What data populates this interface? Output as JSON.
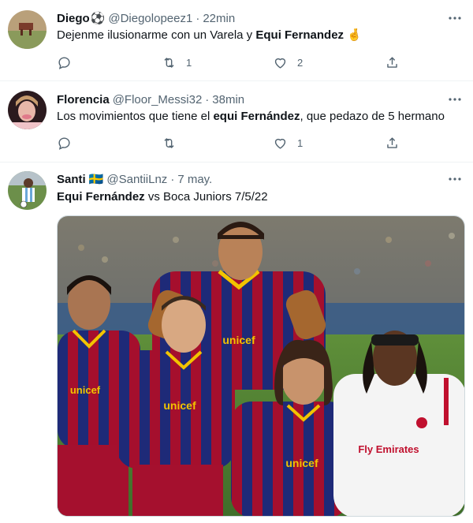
{
  "tweets": [
    {
      "name": "Diego",
      "badge": "⚽",
      "handle": "@Diegolopeez1",
      "time": "22min",
      "text_parts": [
        "Dejenme ilusionarme con un Varela y ",
        "Equi Fernandez",
        " 🤞"
      ],
      "replies": "",
      "retweets": "1",
      "likes": "2"
    },
    {
      "name": "Florencia",
      "handle": "@Floor_Messi32",
      "time": "38min",
      "text_parts": [
        "Los movimientos que tiene el ",
        "equi Fernández",
        ", que pedazo de 5 hermano"
      ],
      "replies": "",
      "retweets": "",
      "likes": "1"
    },
    {
      "name": "Santi",
      "badge": "🇸🇪",
      "handle": "@SantiiLnz",
      "time": "7 may.",
      "text_parts": [
        "Equi Fernández",
        " vs Boca Juniors 7/5/22"
      ]
    }
  ],
  "separator": "·",
  "media_overlay": {
    "jersey_sponsor": "unicef",
    "milan_sponsor": "Fly Emirates"
  },
  "colors": {
    "text": "#0f1419",
    "secondary": "#536471",
    "border": "#eff3f4",
    "barca_blue": "#1e2a78",
    "barca_red": "#a50f2d"
  }
}
